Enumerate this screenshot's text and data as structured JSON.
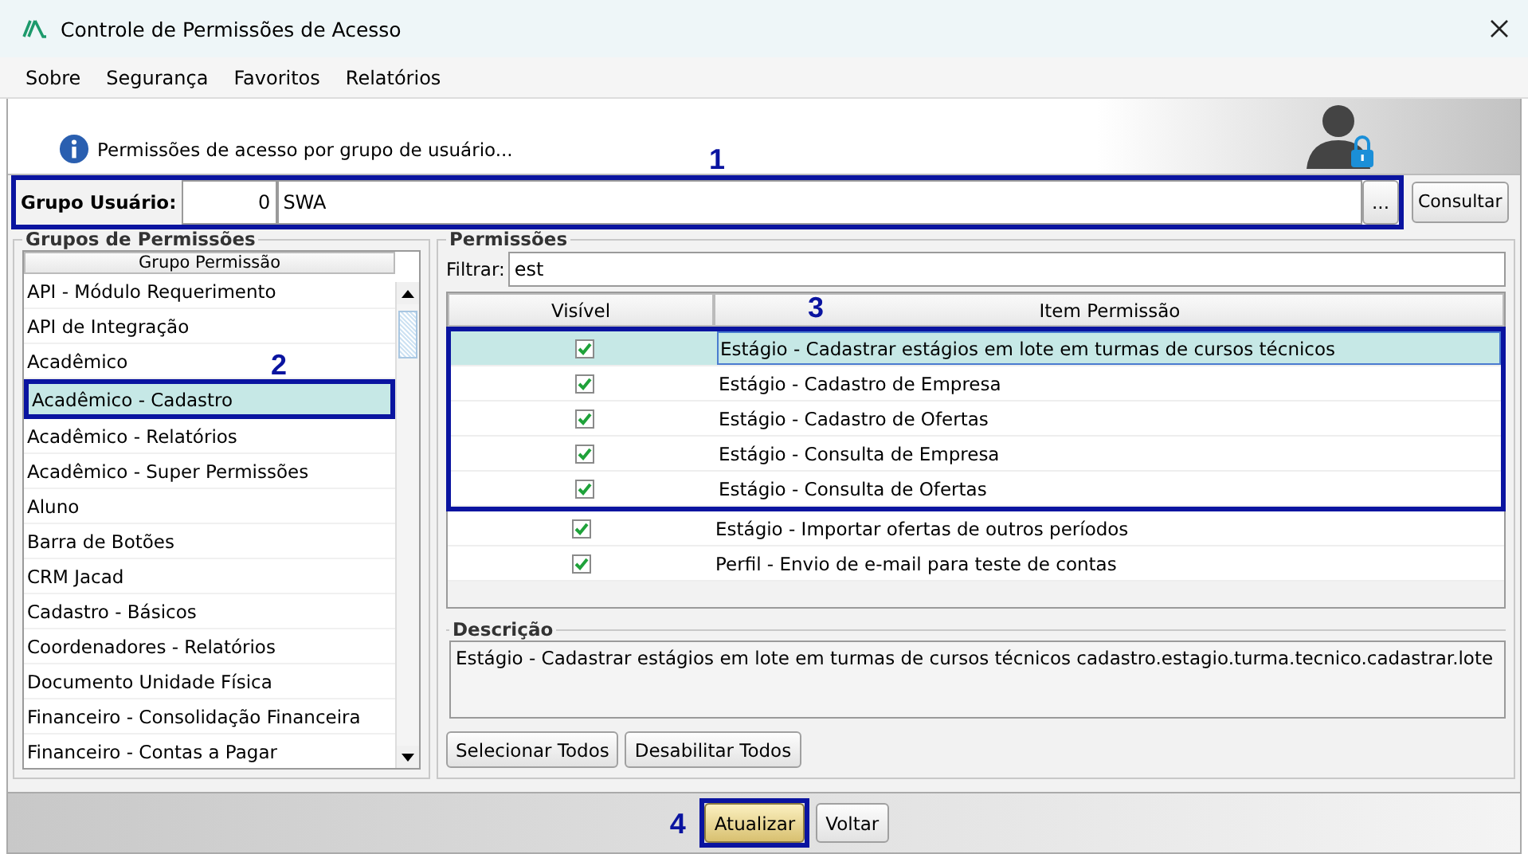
{
  "window": {
    "title": "Controle de Permissões de Acesso"
  },
  "menu": [
    {
      "label": "Sobre"
    },
    {
      "label": "Segurança"
    },
    {
      "label": "Favoritos"
    },
    {
      "label": "Relatórios"
    }
  ],
  "header": {
    "message": "Permissões de acesso por grupo de usuário..."
  },
  "user_group": {
    "label": "Grupo Usuário:",
    "code": "0",
    "name": "SWA",
    "browse_button": "...",
    "query_button": "Consultar",
    "annotation": "1"
  },
  "permission_groups": {
    "title": "Grupos de Permissões",
    "column": "Grupo Permissão",
    "items": [
      {
        "label": "API - Módulo Requerimento",
        "selected": false
      },
      {
        "label": "API de Integração",
        "selected": false
      },
      {
        "label": "Acadêmico",
        "selected": false
      },
      {
        "label": "Acadêmico - Cadastro",
        "selected": true,
        "annotation": "2"
      },
      {
        "label": "Acadêmico - Relatórios",
        "selected": false
      },
      {
        "label": "Acadêmico - Super Permissões",
        "selected": false
      },
      {
        "label": "Aluno",
        "selected": false
      },
      {
        "label": "Barra de Botões",
        "selected": false
      },
      {
        "label": "CRM Jacad",
        "selected": false
      },
      {
        "label": "Cadastro - Básicos",
        "selected": false
      },
      {
        "label": "Coordenadores - Relatórios",
        "selected": false
      },
      {
        "label": "Documento Unidade Física",
        "selected": false
      },
      {
        "label": "Financeiro - Consolidação Financeira",
        "selected": false
      },
      {
        "label": "Financeiro - Contas a Pagar",
        "selected": false
      }
    ]
  },
  "permissions": {
    "title": "Permissões",
    "filter_label": "Filtrar:",
    "filter_value": "est",
    "columns": [
      "Visível",
      "Item Permissão"
    ],
    "highlight_annotation": "3",
    "rows": [
      {
        "item": "Estágio - Cadastrar estágios em lote em turmas de cursos técnicos",
        "visible": true,
        "selected": true,
        "highlighted": true
      },
      {
        "item": "Estágio - Cadastro de Empresa",
        "visible": true,
        "selected": false,
        "highlighted": true
      },
      {
        "item": "Estágio - Cadastro de Ofertas",
        "visible": true,
        "selected": false,
        "highlighted": true
      },
      {
        "item": "Estágio - Consulta de Empresa",
        "visible": true,
        "selected": false,
        "highlighted": true
      },
      {
        "item": "Estágio - Consulta de Ofertas",
        "visible": true,
        "selected": false,
        "highlighted": true
      },
      {
        "item": "Estágio - Importar ofertas de outros períodos",
        "visible": true,
        "selected": false,
        "highlighted": false
      },
      {
        "item": "Perfil - Envio de e-mail para teste de contas",
        "visible": true,
        "selected": false,
        "highlighted": false
      }
    ]
  },
  "description": {
    "title": "Descrição",
    "text": "Estágio - Cadastrar estágios em lote em turmas de cursos técnicos cadastro.estagio.turma.tecnico.cadastrar.lote"
  },
  "action_buttons": [
    "Selecionar Todos",
    "Desabilitar Todos"
  ],
  "footer_buttons": [
    {
      "label": "Atualizar",
      "default": true,
      "annotation": "4"
    },
    {
      "label": "Voltar",
      "default": false
    }
  ]
}
